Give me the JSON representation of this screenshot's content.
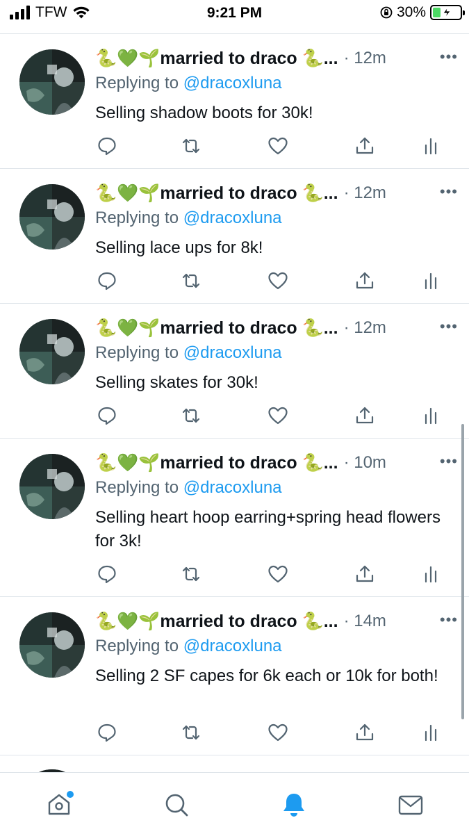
{
  "status_bar": {
    "carrier": "TFW",
    "time": "9:21 PM",
    "battery_percent": "30%",
    "battery_level": 0.3
  },
  "tweets": [
    {
      "author_name": "🐍💚🌱married to draco 🐍...",
      "time": "· 12m",
      "replying_prefix": "Replying to ",
      "handle": "@dracoxluna",
      "text": "Selling shadow boots for 30k!"
    },
    {
      "author_name": "🐍💚🌱married to draco 🐍...",
      "time": "· 12m",
      "replying_prefix": "Replying to ",
      "handle": "@dracoxluna",
      "text": "Selling lace ups for 8k!"
    },
    {
      "author_name": "🐍💚🌱married to draco 🐍...",
      "time": "· 12m",
      "replying_prefix": "Replying to ",
      "handle": "@dracoxluna",
      "text": "Selling skates for 30k!"
    },
    {
      "author_name": "🐍💚🌱married to draco 🐍...",
      "time": "· 10m",
      "replying_prefix": "Replying to ",
      "handle": "@dracoxluna",
      "text": "Selling heart hoop earring+spring head flowers for 3k!"
    },
    {
      "author_name": "🐍💚🌱married to draco 🐍...",
      "time": "· 14m",
      "replying_prefix": "Replying to ",
      "handle": "@dracoxluna",
      "text": "Selling 2 SF capes for 6k each or 10k for both!"
    }
  ],
  "tab_bar": {
    "items": [
      "home-icon",
      "search-icon",
      "notifications-icon",
      "messages-icon"
    ],
    "active": "notifications-icon",
    "home_has_new": true
  },
  "colors": {
    "accent": "#1d9bf0",
    "muted_text": "#536471",
    "divider": "#dfe5ea",
    "battery_charging": "#4cd964"
  }
}
